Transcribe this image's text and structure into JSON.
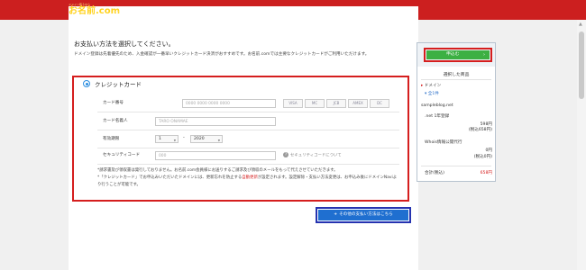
{
  "header": {
    "logo_tagline": "ドメイン取るなら",
    "logo_text": "お名前.com",
    "logo_sub": "by GMO"
  },
  "main": {
    "heading": "お支払い方法を選択してください。",
    "description": "ドメイン登録は先着優先のため、入金確認が一番早いクレジットカード決済がおすすめです。お名前.comでは主要なクレジットカードがご利用いただけます。",
    "credit_card": {
      "title": "クレジットカード",
      "card_number_label": "カード番号",
      "card_number_placeholder": "0000 0000 0000 0000",
      "brands": [
        "VISA",
        "MC",
        "JCB",
        "AMEX",
        "DC"
      ],
      "card_name_label": "カード名義人",
      "card_name_placeholder": "TARO ONAMAE",
      "expiry_label": "有効期限",
      "expiry_month": "1",
      "expiry_sep": "-",
      "expiry_year": "2020",
      "security_label": "セキュリティコード",
      "security_placeholder": "000",
      "security_help": "セキュリティコードについて",
      "note1": "*請求書及び領収書は発行しておりません。お名前.com会員様にお送りするご請求及び領収のメールをもって代えさせていただきます。",
      "note2_prefix": "*「クレジットカード」でお申込みいただいたドメインには、更新忘れを防止する",
      "note2_red": "自動更新",
      "note2_suffix": "が設定されます。設定解除・支払い方法変更は、お申込み後にドメインNaviより行うことが可能です。"
    },
    "other_payment_button": "その他の支払い方法はこちら"
  },
  "sidebar": {
    "apply_button": "申込む",
    "selected_title": "選択した商品",
    "domain_label": "ドメイン",
    "domain_count": "全1件",
    "domain_name": "sampleblog.net",
    "plan_label": ".net 1年登録",
    "plan_price": "598円",
    "plan_price_tax": "(税込658円)",
    "whois_label": "Whois情報公開代行",
    "whois_price": "0円",
    "whois_price_tax": "(税込0円)",
    "total_label": "合計(税込)",
    "total_value": "658円"
  },
  "colors": {
    "header_red": "#cc1f1f",
    "highlight_red": "#d51e1e",
    "apply_green": "#3cb043",
    "other_button_blue": "#1f6fd0"
  }
}
